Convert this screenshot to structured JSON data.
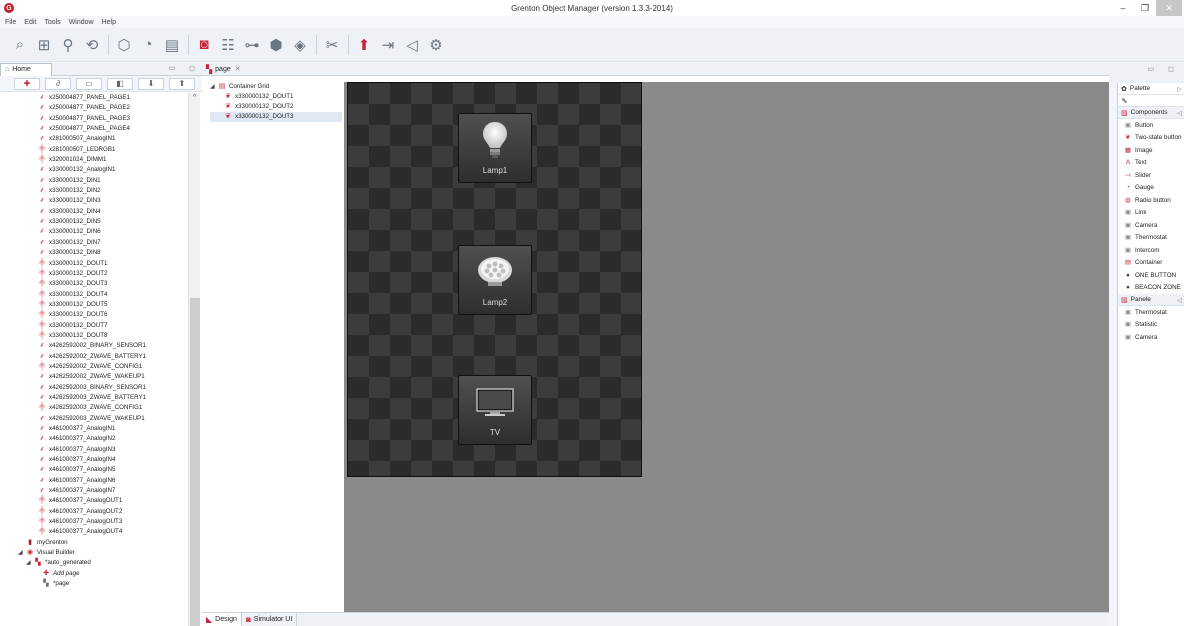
{
  "window": {
    "title": "Grenton Object Manager (version 1.3.3-2014)",
    "app_icon_glyph": "G",
    "controls": [
      "–",
      "❐",
      "✕"
    ]
  },
  "menu": [
    "File",
    "Edit",
    "Tools",
    "Window",
    "Help"
  ],
  "toolbar": {
    "groups": [
      [
        "search-module-icon",
        "network-icon",
        "wizard-icon",
        "refresh-icon"
      ],
      [
        "cube-icon",
        "clock-icon",
        "config-icon"
      ],
      [
        "grenton-logo-icon",
        "structure-icon",
        "hierarchy-icon",
        "visual-builder-icon",
        "simulator-icon"
      ],
      [
        "disconnect-icon"
      ],
      [
        "send-icon",
        "export-icon",
        "back-icon",
        "settings-icon"
      ]
    ]
  },
  "left_panel": {
    "tab_label": "Home",
    "tab_controls": "▭ ◻",
    "tree_items": [
      {
        "label": "x250004877_PANEL_PAGE1",
        "icon": "in"
      },
      {
        "label": "x250004877_PANEL_PAGE2",
        "icon": "in"
      },
      {
        "label": "x250004877_PANEL_PAGE3",
        "icon": "in"
      },
      {
        "label": "x250004877_PANEL_PAGE4",
        "icon": "in"
      },
      {
        "label": "x281000507_AnalogIN1",
        "icon": "in"
      },
      {
        "label": "x281000507_LEDRGB1",
        "icon": "out"
      },
      {
        "label": "x320001024_DIMM1",
        "icon": "out"
      },
      {
        "label": "x330000132_AnalogIN1",
        "icon": "in"
      },
      {
        "label": "x330000132_DIN1",
        "icon": "in"
      },
      {
        "label": "x330000132_DIN2",
        "icon": "in"
      },
      {
        "label": "x330000132_DIN3",
        "icon": "in"
      },
      {
        "label": "x330000132_DIN4",
        "icon": "in"
      },
      {
        "label": "x330000132_DIN5",
        "icon": "in"
      },
      {
        "label": "x330000132_DIN6",
        "icon": "in"
      },
      {
        "label": "x330000132_DIN7",
        "icon": "in"
      },
      {
        "label": "x330000132_DIN8",
        "icon": "in"
      },
      {
        "label": "x330000132_DOUT1",
        "icon": "out"
      },
      {
        "label": "x330000132_DOUT2",
        "icon": "out"
      },
      {
        "label": "x330000132_DOUT3",
        "icon": "out"
      },
      {
        "label": "x330000132_DOUT4",
        "icon": "out"
      },
      {
        "label": "x330000132_DOUT5",
        "icon": "out"
      },
      {
        "label": "x330000132_DOUT6",
        "icon": "out"
      },
      {
        "label": "x330000132_DOUT7",
        "icon": "out"
      },
      {
        "label": "x330000132_DOUT8",
        "icon": "out"
      },
      {
        "label": "x4262592002_BINARY_SENSOR1",
        "icon": "in"
      },
      {
        "label": "x4262592002_ZWAVE_BATTERY1",
        "icon": "in"
      },
      {
        "label": "x4262592002_ZWAVE_CONFIG1",
        "icon": "out"
      },
      {
        "label": "x4262592002_ZWAVE_WAKEUP1",
        "icon": "in"
      },
      {
        "label": "x4262592003_BINARY_SENSOR1",
        "icon": "in"
      },
      {
        "label": "x4262592003_ZWAVE_BATTERY1",
        "icon": "in"
      },
      {
        "label": "x4262592003_ZWAVE_CONFIG1",
        "icon": "out"
      },
      {
        "label": "x4262592003_ZWAVE_WAKEUP1",
        "icon": "in"
      },
      {
        "label": "x461000377_AnalogIN1",
        "icon": "in"
      },
      {
        "label": "x461000377_AnalogIN2",
        "icon": "in"
      },
      {
        "label": "x461000377_AnalogIN3",
        "icon": "in"
      },
      {
        "label": "x461000377_AnalogIN4",
        "icon": "in"
      },
      {
        "label": "x461000377_AnalogIN5",
        "icon": "in"
      },
      {
        "label": "x461000377_AnalogIN6",
        "icon": "in"
      },
      {
        "label": "x461000377_AnalogIN7",
        "icon": "in"
      },
      {
        "label": "x461000377_AnalogOUT1",
        "icon": "out"
      },
      {
        "label": "x461000377_AnalogOUT2",
        "icon": "out"
      },
      {
        "label": "x461000377_AnalogOUT3",
        "icon": "out"
      },
      {
        "label": "x461000377_AnalogOUT4",
        "icon": "out"
      }
    ],
    "my_grenton": "myGrenton",
    "visual_builder": "Visual Builder",
    "auto_generated": "*auto_generated",
    "add_page": "Add page",
    "page_item": "*page"
  },
  "editor": {
    "tab_label": "page",
    "tab_close": "✕",
    "outline": {
      "root": "Container Grid",
      "children": [
        "x330000132_DOUT1",
        "x330000132_DOUT2",
        "x330000132_DOUT3"
      ],
      "selected_index": 2
    },
    "widgets": [
      {
        "label": "Lamp1",
        "icon": "bulb-icon"
      },
      {
        "label": "Lamp2",
        "icon": "led-lamp-icon"
      },
      {
        "label": "TV",
        "icon": "tv-icon"
      }
    ],
    "bottom_tabs": [
      "Design",
      "Simulator UI"
    ]
  },
  "palette": {
    "title": "Palette",
    "groups": [
      {
        "label": "Components",
        "items": [
          {
            "label": "Button",
            "icon": "button-icon"
          },
          {
            "label": "Two-state button",
            "icon": "two-state-icon"
          },
          {
            "label": "Image",
            "icon": "image-icon"
          },
          {
            "label": "Text",
            "icon": "text-icon"
          },
          {
            "label": "Slider",
            "icon": "slider-icon"
          },
          {
            "label": "Gauge",
            "icon": "gauge-icon"
          },
          {
            "label": "Radio button",
            "icon": "radio-icon"
          },
          {
            "label": "Link",
            "icon": "link-icon"
          },
          {
            "label": "Camera",
            "icon": "camera-icon"
          },
          {
            "label": "Thermostat",
            "icon": "thermostat-icon"
          },
          {
            "label": "Intercom",
            "icon": "intercom-icon"
          },
          {
            "label": "Container",
            "icon": "container-icon"
          },
          {
            "label": "ONE BUTTON",
            "icon": "one-button-icon"
          },
          {
            "label": "BEACON ZONE",
            "icon": "beacon-icon"
          }
        ]
      },
      {
        "label": "Panele",
        "items": [
          {
            "label": "Thermostat",
            "icon": "thermostat-icon"
          },
          {
            "label": "Statistic",
            "icon": "statistic-icon"
          },
          {
            "label": "Camera",
            "icon": "camera-icon"
          }
        ]
      }
    ]
  },
  "colors": {
    "accent_red": "#c8253a",
    "canvas_bg": "#8a8a8a",
    "grid_dark": "#2b2b2b"
  }
}
